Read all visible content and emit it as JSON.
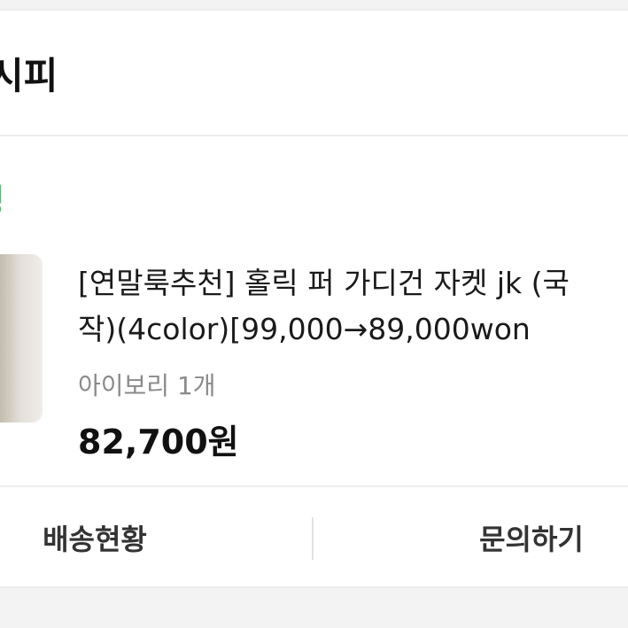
{
  "order": {
    "store_name": "시피",
    "status": "정",
    "status_color": "#40c36d",
    "product": {
      "title_line1": "[연말룩추천] 홀릭 퍼 가디건 자켓 jk (국",
      "title_line2": "작)(4color)[99,000→89,000won",
      "option": "아이보리 1개",
      "price": "82,700원"
    }
  },
  "actions": {
    "delivery_status": "배송현황",
    "inquiry": "문의하기"
  }
}
